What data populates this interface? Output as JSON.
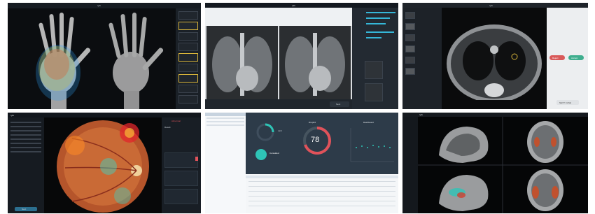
{
  "panels": {
    "hand": {
      "title": "ryfo",
      "thumb_count": 9
    },
    "chest": {
      "brand": "ryfo",
      "action_button": "Next"
    },
    "ct": {
      "title": "ryfo",
      "cancel_label": "Reject",
      "confirm_label": "Accept",
      "bottom_button": "NEXT CASE"
    },
    "retina": {
      "brand": "ryfo",
      "badge": "Abnormal",
      "page_label": "Result",
      "bottom_button": "Next"
    },
    "dashboard": {
      "gauge_title": "Dropfrd",
      "gauge_value": "78",
      "right_title": "Dashboard",
      "left_stat_label": "ntrnl",
      "pill_label": "Consulted"
    },
    "mri": {
      "brand": "ryfo"
    }
  },
  "colors": {
    "accent_teal": "#2ec4b6",
    "accent_cyan": "#35b7d8",
    "gauge_red": "#e0525a",
    "confirm_green": "#3fae8e",
    "reject_red": "#d95a5a",
    "highlight_yellow": "#d7b43a"
  }
}
